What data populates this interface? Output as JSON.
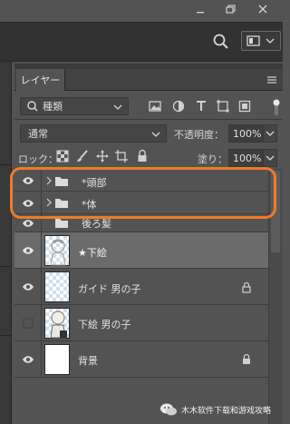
{
  "panel": {
    "tab_label": "レイヤー",
    "kind_filter": "種類",
    "blend_mode": "通常",
    "opacity_label": "不透明度：",
    "opacity_value": "100%",
    "lock_label": "ロック：",
    "fill_label": "塗り：",
    "fill_value": "100%"
  },
  "layers": [
    {
      "name": "*頭部",
      "type": "group",
      "visible": true
    },
    {
      "name": "*体",
      "type": "group",
      "visible": true
    },
    {
      "name": "後ろ髪",
      "type": "group",
      "visible": true
    },
    {
      "name": "★下絵",
      "type": "layer",
      "visible": true,
      "selected": true
    },
    {
      "name": "ガイド 男の子",
      "type": "layer",
      "visible": true,
      "locked": true
    },
    {
      "name": "下絵 男の子",
      "type": "layer",
      "visible": false
    },
    {
      "name": "背景",
      "type": "layer",
      "visible": true,
      "locked": true
    }
  ],
  "watermark": {
    "text": "木木软件下载和游戏攻略"
  },
  "colors": {
    "highlight": "#f07a2a",
    "selected_row": "#6b6b6b",
    "panel_bg": "#535353"
  },
  "icons": [
    "eye-icon",
    "folder-icon",
    "lock-icon",
    "search-icon",
    "panel-menu-icon"
  ]
}
